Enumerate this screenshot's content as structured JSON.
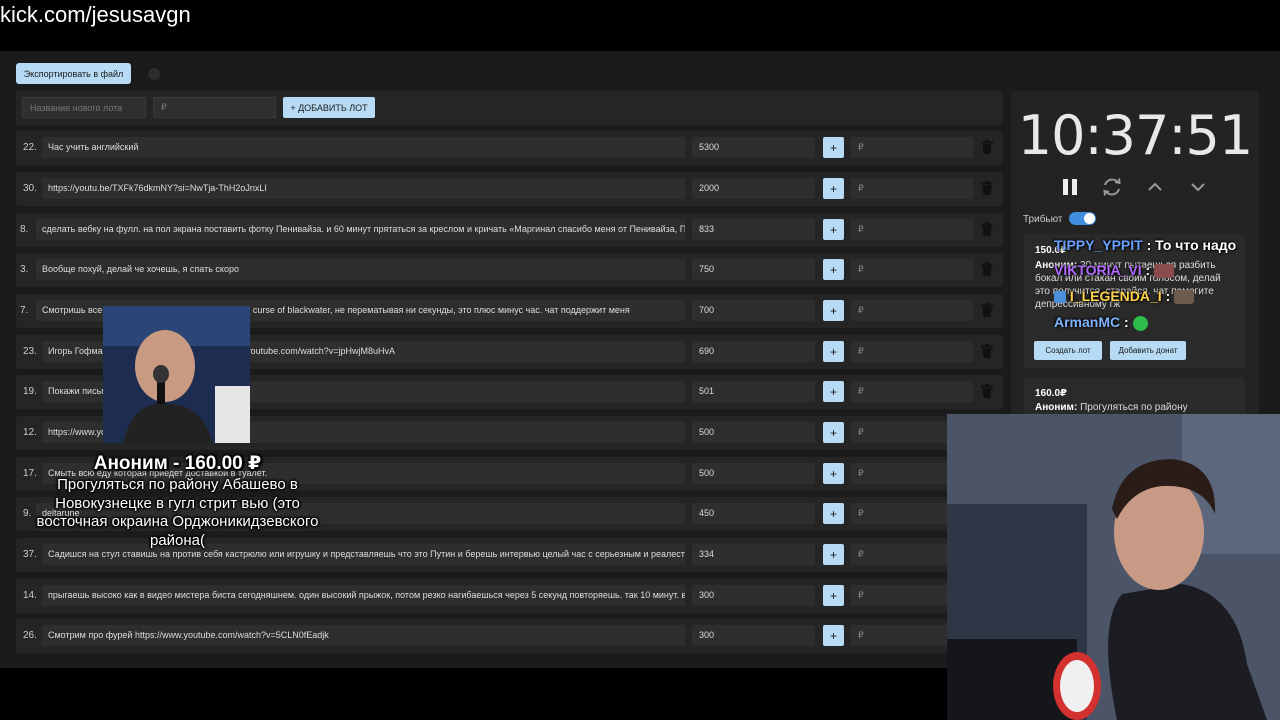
{
  "browser": {
    "url": "kick.com/jesusavgn"
  },
  "toolbar": {
    "export_label": "Экспортировать в файл"
  },
  "new_lot": {
    "name_placeholder": "Название нового лота",
    "price_placeholder": "₽",
    "add_label": "+ ДОБАВИТЬ ЛОТ"
  },
  "lots": [
    {
      "num": "22.",
      "text": "Час учить английский",
      "amount": "5300",
      "plus": "+",
      "rub": "₽"
    },
    {
      "num": "30.",
      "text": "https://youtu.be/TXFk76dkmNY?si=NwTja-ThH2oJnxLI",
      "amount": "2000",
      "plus": "+",
      "rub": "₽"
    },
    {
      "num": "8.",
      "text": "сделать вебку на фулл. на пол экрана поставить фотку Пенивайза. и 60 минут прятаться за креслом и кричать «Маргинал спасибо меня от Пенивайза, П",
      "amount": "833",
      "plus": "+",
      "rub": "₽"
    },
    {
      "num": "3.",
      "text": "Вообще похуй, делай че хочешь, я спать скоро",
      "amount": "750",
      "plus": "+",
      "rub": "₽"
    },
    {
      "num": "7.",
      "text": "Смотришь все                                     хождение the curse of blackwater, не перематывая ни секунды, это плюс минус час. чат поддержит меня",
      "amount": "700",
      "plus": "+",
      "rub": "₽"
    },
    {
      "num": "23.",
      "text": "Игорь Гофма                                      https://www.youtube.com/watch?v=jpHwjM8uHvA",
      "amount": "690",
      "plus": "+",
      "rub": "₽"
    },
    {
      "num": "19.",
      "text": "Покажи письм                                     re",
      "amount": "501",
      "plus": "+",
      "rub": "₽"
    },
    {
      "num": "12.",
      "text": "https://www.yo",
      "amount": "500",
      "plus": "+",
      "rub": "₽"
    },
    {
      "num": "17.",
      "text": "Смыть всю еду которая приедет доставкой в туалет.",
      "amount": "500",
      "plus": "+",
      "rub": "₽"
    },
    {
      "num": "9.",
      "text": "deltarune",
      "amount": "450",
      "plus": "+",
      "rub": "₽"
    },
    {
      "num": "37.",
      "text": "Садишся на стул ставишь на против себя кастрюлю или игрушку и представляешь что это Путин и берешь интервью целый час с серьезным и реалести",
      "amount": "334",
      "plus": "+",
      "rub": "₽"
    },
    {
      "num": "14.",
      "text": "прыгаешь высоко как в видео мистера биста сегодняшнем. один высокий прыжок, потом резко нагибаешься через 5 секунд повторяешь. так 10 минут. в",
      "amount": "300",
      "plus": "+",
      "rub": "₽"
    },
    {
      "num": "26.",
      "text": "Смотрим про фурей https://www.youtube.com/watch?v=5CLN0fEadjk",
      "amount": "300",
      "plus": "+",
      "rub": "₽"
    }
  ],
  "timer": {
    "value": "10:37:51"
  },
  "tribute": {
    "label": "Трибьют",
    "enabled": true
  },
  "donations": [
    {
      "amount": "150.0₽",
      "author": "Аноним:",
      "text": "30 минут пытаешься разбить бокал или стакан своим голосом, делай это                           получится, старайся. чат помогите депрессивному гж",
      "create_label": "Создать лот",
      "add_label": "Добавить донат"
    },
    {
      "amount": "160.0₽",
      "author": "Аноним:",
      "text": "Прогуляться по району"
    }
  ],
  "chat": [
    {
      "user": "TIPPY_YPPIT",
      "sep": " : ",
      "msg": "То что надо",
      "color": "#6aa0ff"
    },
    {
      "user": "VIKTORIA_VI",
      "sep": " : ",
      "msg": "",
      "color": "#b36bff"
    },
    {
      "user": "I_LEGENDA_I",
      "sep": " : ",
      "msg": "",
      "color": "#ffd24a"
    },
    {
      "user": "ArmanMC",
      "sep": " : ",
      "msg": "",
      "color": "#7fb2ff"
    }
  ],
  "alert": {
    "title": "Аноним - 160.00 ₽",
    "message": "Прогуляться по району Абашево в Новокузнецке в гугл стрит вью (это восточная окраина Орджоникидзевского района("
  },
  "colors": {
    "accent": "#b7dbf5",
    "panel": "#252525",
    "toggle": "#3f8ee0"
  }
}
